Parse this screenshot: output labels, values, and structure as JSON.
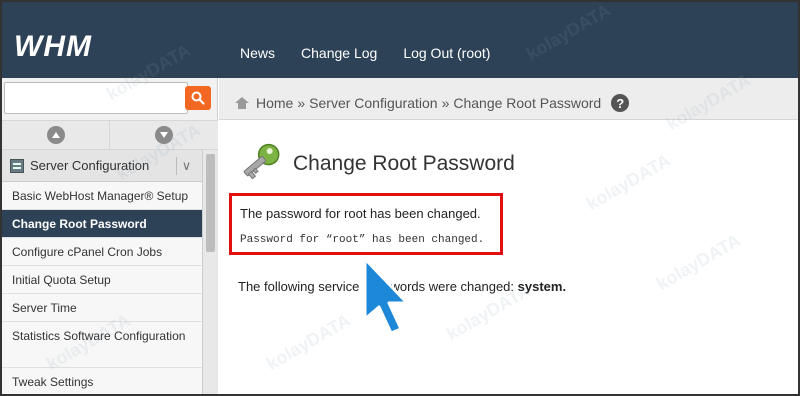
{
  "app": {
    "logo_text": "WHM"
  },
  "topnav": {
    "items": [
      {
        "label": "News"
      },
      {
        "label": "Change Log"
      },
      {
        "label": "Log Out (root)"
      }
    ]
  },
  "sidebar": {
    "search": {
      "value": "",
      "placeholder": ""
    },
    "category": {
      "label": "Server Configuration",
      "toggle": "∨"
    },
    "items": [
      {
        "label": "Basic WebHost Manager® Setup"
      },
      {
        "label": "Change Root Password",
        "active": true
      },
      {
        "label": "Configure cPanel Cron Jobs"
      },
      {
        "label": "Initial Quota Setup"
      },
      {
        "label": "Server Time"
      },
      {
        "label": "Statistics Software Configuration"
      },
      {
        "label": "Tweak Settings"
      }
    ]
  },
  "breadcrumb": {
    "home": "Home",
    "separator": "»",
    "section": "Server Configuration",
    "current": "Change Root Password",
    "help": "?"
  },
  "main": {
    "title": "Change Root Password",
    "message_primary": "The password for root has been changed.",
    "message_secondary": "Password for “root” has been changed.",
    "services_text": "The following service passwords were changed: ",
    "services_value": "system."
  },
  "watermark": {
    "text": "kolayDATA"
  },
  "colors": {
    "header_bg": "#2d4256",
    "accent_orange": "#f26722",
    "highlight_red": "#e01010",
    "pointer_blue": "#1e88d8"
  }
}
